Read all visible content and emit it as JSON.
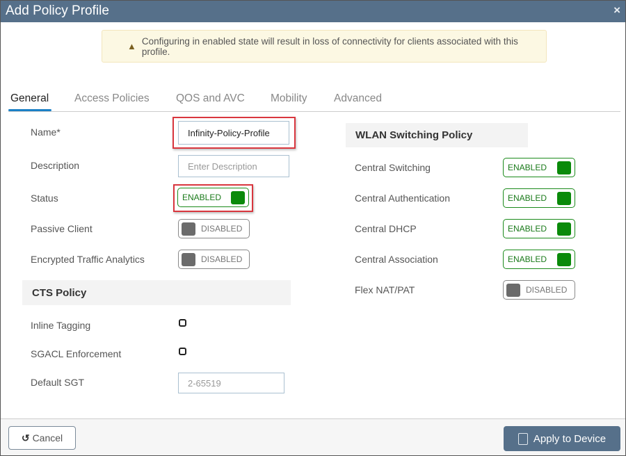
{
  "dialog": {
    "title": "Add Policy Profile",
    "close_icon": "×"
  },
  "banner": {
    "icon": "warning-triangle-icon",
    "text": "Configuring in enabled state will result in loss of connectivity for clients associated with this profile."
  },
  "tabs": [
    {
      "label": "General",
      "active": true
    },
    {
      "label": "Access Policies"
    },
    {
      "label": "QOS and AVC"
    },
    {
      "label": "Mobility"
    },
    {
      "label": "Advanced"
    }
  ],
  "general": {
    "name": {
      "label": "Name*",
      "value": "Infinity-Policy-Profile"
    },
    "description": {
      "label": "Description",
      "placeholder": "Enter Description"
    },
    "status": {
      "label": "Status",
      "state": "ENABLED"
    },
    "passive_client": {
      "label": "Passive Client",
      "state": "DISABLED"
    },
    "eta": {
      "label": "Encrypted Traffic Analytics",
      "state": "DISABLED"
    },
    "cts": {
      "heading": "CTS Policy",
      "inline_tagging": "Inline Tagging",
      "sgacl": "SGACL Enforcement",
      "default_sgt": {
        "label": "Default SGT",
        "placeholder": "2-65519"
      }
    }
  },
  "wlan_switching": {
    "heading": "WLAN Switching Policy",
    "items": [
      {
        "label": "Central Switching",
        "state": "ENABLED"
      },
      {
        "label": "Central Authentication",
        "state": "ENABLED"
      },
      {
        "label": "Central DHCP",
        "state": "ENABLED"
      },
      {
        "label": "Central Association",
        "state": "ENABLED"
      },
      {
        "label": "Flex NAT/PAT",
        "state": "DISABLED"
      }
    ]
  },
  "footer": {
    "cancel": "Cancel",
    "apply": "Apply to Device"
  },
  "colors": {
    "header": "#56708a",
    "enabled": "#0a8a0a",
    "highlight": "#d9363e"
  }
}
